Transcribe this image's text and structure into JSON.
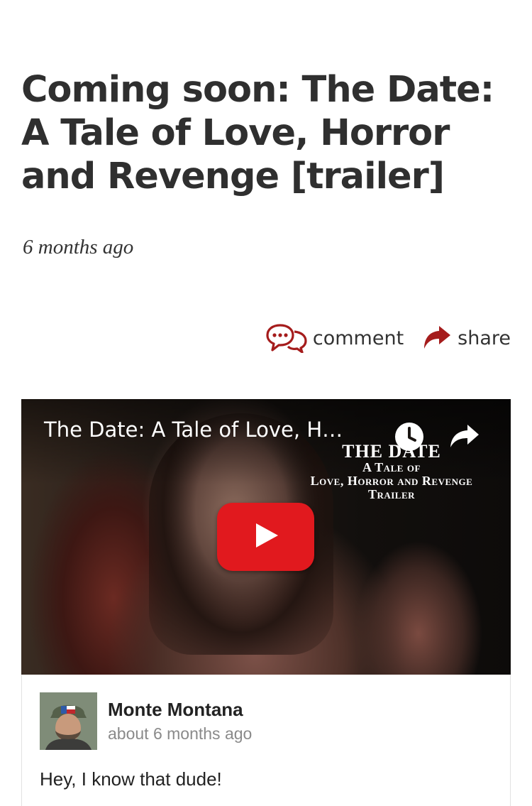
{
  "article": {
    "title": "Coming soon: The Date: A Tale of Love, Horror and Revenge [trailer]",
    "timestamp": "6 months ago"
  },
  "actions": {
    "comment_label": "comment",
    "share_label": "share"
  },
  "video": {
    "title": "The Date: A Tale of Love, H…",
    "overlay": {
      "name": "THE DATE",
      "line1": "A Tale of",
      "line2": "Love, Horror and Revenge",
      "line3": "Trailer"
    }
  },
  "comment": {
    "author": "Monte Montana",
    "time": "about 6 months ago",
    "text": "Hey, I know that dude!"
  },
  "colors": {
    "accent": "#a51c1c",
    "youtube_red": "#e1191e",
    "title_text": "#2f2f2f",
    "muted_text": "#8a8a8a"
  },
  "icons": {
    "comment": "comment-bubble-icon",
    "share": "share-arrow-icon",
    "play": "play-icon",
    "clock": "clock-icon",
    "video_share": "share-arrow-icon"
  }
}
